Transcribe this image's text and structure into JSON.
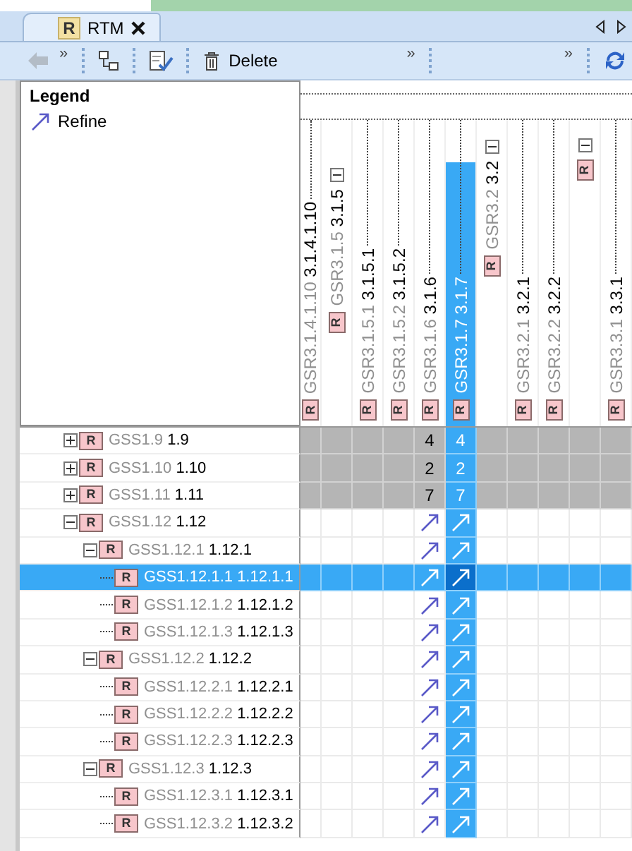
{
  "tab": {
    "badge": "R",
    "title": "RTM",
    "selected": true
  },
  "toolbar": {
    "items": [
      {
        "kind": "back",
        "disabled": true
      },
      {
        "kind": "overflow",
        "text": "»",
        "group_start": false
      },
      {
        "kind": "tree",
        "group_start": true
      },
      {
        "kind": "check-doc",
        "group_start": true
      },
      {
        "kind": "delete",
        "label": "Delete",
        "group_start": true
      },
      {
        "kind": "overflow",
        "text": "»",
        "group_start": false
      },
      {
        "kind": "overflow",
        "text": "»",
        "group_start": true
      },
      {
        "kind": "refresh",
        "group_start": true
      }
    ]
  },
  "legend": {
    "title": "Legend",
    "items": [
      {
        "label": "Refine"
      }
    ]
  },
  "columns": [
    {
      "kind": "leaf",
      "badge": "R",
      "id": "GSR3.1.4.1.10",
      "number": "3.1.4.1.10",
      "selected": false
    },
    {
      "kind": "subgroup",
      "badge": "R",
      "id": "GSR3.1.5",
      "number": "3.1.5",
      "expanded": true,
      "selected": false
    },
    {
      "kind": "leaf",
      "badge": "R",
      "id": "GSR3.1.5.1",
      "number": "3.1.5.1",
      "selected": false
    },
    {
      "kind": "leaf",
      "badge": "R",
      "id": "GSR3.1.5.2",
      "number": "3.1.5.2",
      "selected": false
    },
    {
      "kind": "leaf",
      "badge": "R",
      "id": "GSR3.1.6",
      "number": "3.1.6",
      "selected": false
    },
    {
      "kind": "leaf",
      "badge": "R",
      "id": "GSR3.1.7",
      "number": "3.1.7",
      "selected": true
    },
    {
      "kind": "group",
      "badge": "R",
      "id": "GSR3.2",
      "number": "3.2",
      "expanded": true,
      "selected": false
    },
    {
      "kind": "leaf",
      "badge": "R",
      "id": "GSR3.2.1",
      "number": "3.2.1",
      "selected": false
    },
    {
      "kind": "leaf",
      "badge": "R",
      "id": "GSR3.2.2",
      "number": "3.2.2",
      "selected": false
    },
    {
      "kind": "stub",
      "badge": "R",
      "expanded": true,
      "selected": false
    },
    {
      "kind": "leaf",
      "badge": "R",
      "id": "GSR3.3.1",
      "number": "3.3.1",
      "selected": false
    }
  ],
  "rows": [
    {
      "badge": "R",
      "id": "GSS1.9",
      "number": "1.9",
      "expanded": false,
      "selected": false,
      "cells": [
        {
          "kind": "none"
        },
        {
          "kind": "none"
        },
        {
          "kind": "none"
        },
        {
          "kind": "none"
        },
        {
          "kind": "count",
          "text": "4"
        },
        {
          "kind": "count",
          "text": "4"
        },
        {
          "kind": "none"
        },
        {
          "kind": "none"
        },
        {
          "kind": "none"
        },
        {
          "kind": "none"
        },
        {
          "kind": "none"
        }
      ]
    },
    {
      "badge": "R",
      "id": "GSS1.10",
      "number": "1.10",
      "expanded": false,
      "selected": false,
      "cells": [
        {
          "kind": "none"
        },
        {
          "kind": "none"
        },
        {
          "kind": "none"
        },
        {
          "kind": "none"
        },
        {
          "kind": "count",
          "text": "2"
        },
        {
          "kind": "count",
          "text": "2"
        },
        {
          "kind": "none"
        },
        {
          "kind": "none"
        },
        {
          "kind": "none"
        },
        {
          "kind": "none"
        },
        {
          "kind": "none"
        }
      ]
    },
    {
      "badge": "R",
      "id": "GSS1.11",
      "number": "1.11",
      "expanded": false,
      "selected": false,
      "cells": [
        {
          "kind": "none"
        },
        {
          "kind": "none"
        },
        {
          "kind": "none"
        },
        {
          "kind": "none"
        },
        {
          "kind": "count",
          "text": "7"
        },
        {
          "kind": "count",
          "text": "7"
        },
        {
          "kind": "none"
        },
        {
          "kind": "none"
        },
        {
          "kind": "none"
        },
        {
          "kind": "none"
        },
        {
          "kind": "none"
        }
      ]
    },
    {
      "badge": "R",
      "id": "GSS1.12",
      "number": "1.12",
      "expanded": true,
      "selected": false,
      "cells": [
        {
          "kind": "none"
        },
        {
          "kind": "none"
        },
        {
          "kind": "none"
        },
        {
          "kind": "none"
        },
        {
          "kind": "refine"
        },
        {
          "kind": "refine"
        },
        {
          "kind": "none"
        },
        {
          "kind": "none"
        },
        {
          "kind": "none"
        },
        {
          "kind": "none"
        },
        {
          "kind": "none"
        }
      ],
      "children": [
        {
          "badge": "R",
          "id": "GSS1.12.1",
          "number": "1.12.1",
          "expanded": true,
          "selected": false,
          "cells": [
            {
              "kind": "none"
            },
            {
              "kind": "none"
            },
            {
              "kind": "none"
            },
            {
              "kind": "none"
            },
            {
              "kind": "refine"
            },
            {
              "kind": "refine"
            },
            {
              "kind": "none"
            },
            {
              "kind": "none"
            },
            {
              "kind": "none"
            },
            {
              "kind": "none"
            },
            {
              "kind": "none"
            }
          ],
          "children": [
            {
              "badge": "R",
              "id": "GSS1.12.1.1",
              "number": "1.12.1.1",
              "selected": true,
              "cells": [
                {
                  "kind": "none"
                },
                {
                  "kind": "none"
                },
                {
                  "kind": "none"
                },
                {
                  "kind": "none"
                },
                {
                  "kind": "refine"
                },
                {
                  "kind": "refine"
                },
                {
                  "kind": "none"
                },
                {
                  "kind": "none"
                },
                {
                  "kind": "none"
                },
                {
                  "kind": "none"
                },
                {
                  "kind": "none"
                }
              ]
            },
            {
              "badge": "R",
              "id": "GSS1.12.1.2",
              "number": "1.12.1.2",
              "selected": false,
              "cells": [
                {
                  "kind": "none"
                },
                {
                  "kind": "none"
                },
                {
                  "kind": "none"
                },
                {
                  "kind": "none"
                },
                {
                  "kind": "refine"
                },
                {
                  "kind": "refine"
                },
                {
                  "kind": "none"
                },
                {
                  "kind": "none"
                },
                {
                  "kind": "none"
                },
                {
                  "kind": "none"
                },
                {
                  "kind": "none"
                }
              ]
            },
            {
              "badge": "R",
              "id": "GSS1.12.1.3",
              "number": "1.12.1.3",
              "selected": false,
              "cells": [
                {
                  "kind": "none"
                },
                {
                  "kind": "none"
                },
                {
                  "kind": "none"
                },
                {
                  "kind": "none"
                },
                {
                  "kind": "refine"
                },
                {
                  "kind": "refine"
                },
                {
                  "kind": "none"
                },
                {
                  "kind": "none"
                },
                {
                  "kind": "none"
                },
                {
                  "kind": "none"
                },
                {
                  "kind": "none"
                }
              ]
            }
          ]
        },
        {
          "badge": "R",
          "id": "GSS1.12.2",
          "number": "1.12.2",
          "expanded": true,
          "selected": false,
          "cells": [
            {
              "kind": "none"
            },
            {
              "kind": "none"
            },
            {
              "kind": "none"
            },
            {
              "kind": "none"
            },
            {
              "kind": "refine"
            },
            {
              "kind": "refine"
            },
            {
              "kind": "none"
            },
            {
              "kind": "none"
            },
            {
              "kind": "none"
            },
            {
              "kind": "none"
            },
            {
              "kind": "none"
            }
          ],
          "children": [
            {
              "badge": "R",
              "id": "GSS1.12.2.1",
              "number": "1.12.2.1",
              "selected": false,
              "cells": [
                {
                  "kind": "none"
                },
                {
                  "kind": "none"
                },
                {
                  "kind": "none"
                },
                {
                  "kind": "none"
                },
                {
                  "kind": "refine"
                },
                {
                  "kind": "refine"
                },
                {
                  "kind": "none"
                },
                {
                  "kind": "none"
                },
                {
                  "kind": "none"
                },
                {
                  "kind": "none"
                },
                {
                  "kind": "none"
                }
              ]
            },
            {
              "badge": "R",
              "id": "GSS1.12.2.2",
              "number": "1.12.2.2",
              "selected": false,
              "cells": [
                {
                  "kind": "none"
                },
                {
                  "kind": "none"
                },
                {
                  "kind": "none"
                },
                {
                  "kind": "none"
                },
                {
                  "kind": "refine"
                },
                {
                  "kind": "refine"
                },
                {
                  "kind": "none"
                },
                {
                  "kind": "none"
                },
                {
                  "kind": "none"
                },
                {
                  "kind": "none"
                },
                {
                  "kind": "none"
                }
              ]
            },
            {
              "badge": "R",
              "id": "GSS1.12.2.3",
              "number": "1.12.2.3",
              "selected": false,
              "cells": [
                {
                  "kind": "none"
                },
                {
                  "kind": "none"
                },
                {
                  "kind": "none"
                },
                {
                  "kind": "none"
                },
                {
                  "kind": "refine"
                },
                {
                  "kind": "refine"
                },
                {
                  "kind": "none"
                },
                {
                  "kind": "none"
                },
                {
                  "kind": "none"
                },
                {
                  "kind": "none"
                },
                {
                  "kind": "none"
                }
              ]
            }
          ]
        },
        {
          "badge": "R",
          "id": "GSS1.12.3",
          "number": "1.12.3",
          "expanded": true,
          "selected": false,
          "cells": [
            {
              "kind": "none"
            },
            {
              "kind": "none"
            },
            {
              "kind": "none"
            },
            {
              "kind": "none"
            },
            {
              "kind": "refine"
            },
            {
              "kind": "refine"
            },
            {
              "kind": "none"
            },
            {
              "kind": "none"
            },
            {
              "kind": "none"
            },
            {
              "kind": "none"
            },
            {
              "kind": "none"
            }
          ],
          "children": [
            {
              "badge": "R",
              "id": "GSS1.12.3.1",
              "number": "1.12.3.1",
              "selected": false,
              "cells": [
                {
                  "kind": "none"
                },
                {
                  "kind": "none"
                },
                {
                  "kind": "none"
                },
                {
                  "kind": "none"
                },
                {
                  "kind": "refine"
                },
                {
                  "kind": "refine"
                },
                {
                  "kind": "none"
                },
                {
                  "kind": "none"
                },
                {
                  "kind": "none"
                },
                {
                  "kind": "none"
                },
                {
                  "kind": "none"
                }
              ]
            },
            {
              "badge": "R",
              "id": "GSS1.12.3.2",
              "number": "1.12.3.2",
              "selected": false,
              "cells": [
                {
                  "kind": "none"
                },
                {
                  "kind": "none"
                },
                {
                  "kind": "none"
                },
                {
                  "kind": "none"
                },
                {
                  "kind": "refine"
                },
                {
                  "kind": "refine"
                },
                {
                  "kind": "none"
                },
                {
                  "kind": "none"
                },
                {
                  "kind": "none"
                },
                {
                  "kind": "none"
                },
                {
                  "kind": "none"
                }
              ]
            }
          ]
        }
      ]
    }
  ]
}
